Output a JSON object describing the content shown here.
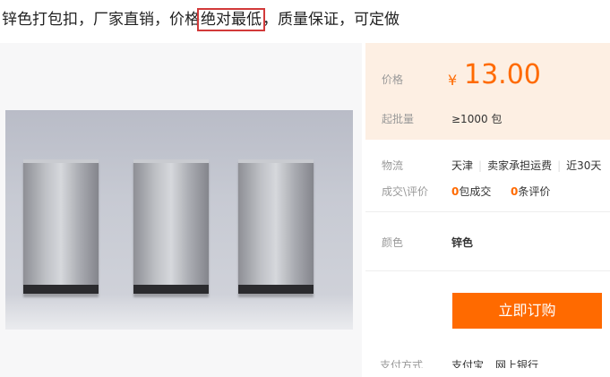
{
  "title": {
    "before": "锌色打包扣，厂家直销，价格",
    "highlight": "绝对最低",
    "after": "，质量保证，可定做"
  },
  "price": {
    "label": "价格",
    "currency": "¥",
    "value": "13.00",
    "min_order_label": "起批量",
    "min_order_value": "≥1000 包"
  },
  "logistics": {
    "label": "物流",
    "origin": "天津",
    "shipping": "卖家承担运费",
    "delivery": "近30天"
  },
  "deals": {
    "label": "成交\\评价",
    "deals_count": "0",
    "deals_text": "包成交",
    "reviews_count": "0",
    "reviews_text": "条评价"
  },
  "color": {
    "label": "颜色",
    "value": "锌色"
  },
  "buy_button": "立即订购",
  "payment": {
    "label": "支付方式",
    "method1": "支付宝",
    "method2": "网上银行"
  }
}
